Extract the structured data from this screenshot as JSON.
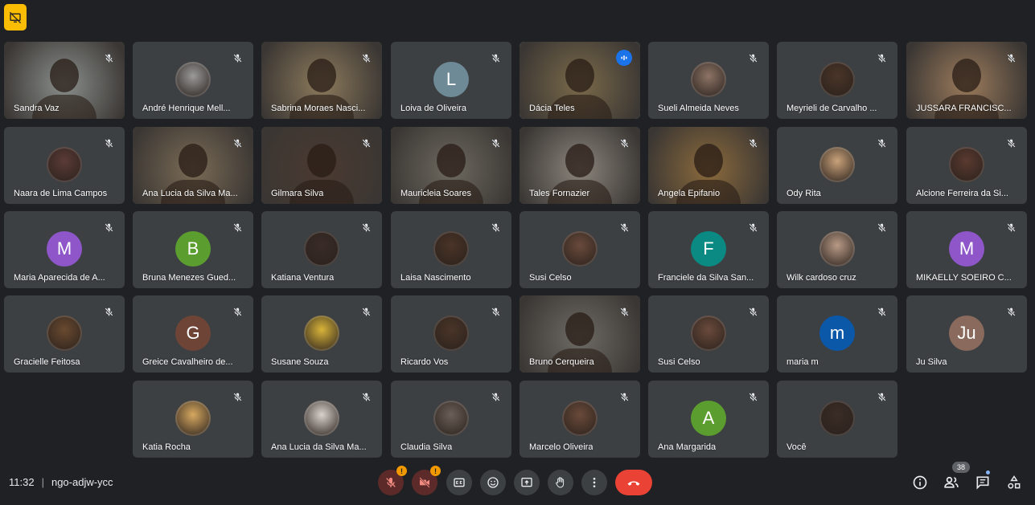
{
  "meeting": {
    "time": "11:32",
    "separator": "|",
    "code": "ngo-adjw-ycc",
    "participant_count": "38"
  },
  "participants": [
    {
      "name": "Sandra Vaz",
      "kind": "video",
      "bg": "#8a8f8c"
    },
    {
      "name": "André Henrique Mell...",
      "kind": "photo",
      "color": "#9a9a9a"
    },
    {
      "name": "Sabrina Moraes Nasci...",
      "kind": "video",
      "bg": "#8c7a5c"
    },
    {
      "name": "Loiva de Oliveira",
      "kind": "letter",
      "letter": "L",
      "color": "#6e8a96"
    },
    {
      "name": "Dácia Teles",
      "kind": "video",
      "bg": "#7a6a4a",
      "active": true
    },
    {
      "name": "Sueli Almeida Neves",
      "kind": "photo",
      "color": "#8d7466"
    },
    {
      "name": "Meyrieli de Carvalho ...",
      "kind": "photo",
      "color": "#4a3528"
    },
    {
      "name": "JUSSARA FRANCISC...",
      "kind": "video",
      "bg": "#9b7b5c"
    },
    {
      "name": "Naara de Lima Campos",
      "kind": "photo",
      "color": "#5b3b37"
    },
    {
      "name": "Ana Lucia da Silva Ma...",
      "kind": "video",
      "bg": "#7a6b55"
    },
    {
      "name": "Gilmara Silva",
      "kind": "video",
      "bg": "#4b3a31"
    },
    {
      "name": "Mauricleia Soares",
      "kind": "video",
      "bg": "#6e6a60"
    },
    {
      "name": "Tales Fornazier",
      "kind": "video",
      "bg": "#8b857c"
    },
    {
      "name": "Angela Epifanio",
      "kind": "video",
      "bg": "#8b6a3c"
    },
    {
      "name": "Ody Rita",
      "kind": "photo",
      "color": "#c9a27a"
    },
    {
      "name": "Alcione Ferreira da Si...",
      "kind": "photo",
      "color": "#5a3a30"
    },
    {
      "name": "Maria Aparecida de A...",
      "kind": "letter",
      "letter": "M",
      "color": "#8e56c8"
    },
    {
      "name": "Bruna Menezes Gued...",
      "kind": "letter",
      "letter": "B",
      "color": "#5b9e2f"
    },
    {
      "name": "Katiana Ventura",
      "kind": "photo",
      "color": "#3a2c28"
    },
    {
      "name": "Laisa Nascimento",
      "kind": "photo",
      "color": "#4a3427"
    },
    {
      "name": "Susi Celso",
      "kind": "photo",
      "color": "#6a4a3c"
    },
    {
      "name": "Franciele da Silva San...",
      "kind": "letter",
      "letter": "F",
      "color": "#0a8a82"
    },
    {
      "name": "Wilk cardoso cruz",
      "kind": "photo",
      "color": "#b89a86"
    },
    {
      "name": "MIKAELLY SOEIRO C...",
      "kind": "letter",
      "letter": "M",
      "color": "#8e56c8"
    },
    {
      "name": "Gracielle Feitosa",
      "kind": "photo",
      "color": "#6a4a30"
    },
    {
      "name": "Greice Cavalheiro de...",
      "kind": "letter",
      "letter": "G",
      "color": "#6d4436"
    },
    {
      "name": "Susane Souza",
      "kind": "photo",
      "color": "#d9b43a"
    },
    {
      "name": "Ricardo Vos",
      "kind": "photo",
      "color": "#4a3528"
    },
    {
      "name": "Bruno Cerqueira",
      "kind": "video",
      "bg": "#6e6a64"
    },
    {
      "name": "Susi Celso",
      "kind": "photo",
      "color": "#6a4a3c"
    },
    {
      "name": "maria m",
      "kind": "letter",
      "letter": "m",
      "color": "#0b57a8"
    },
    {
      "name": "Ju Silva",
      "kind": "letter",
      "letter": "Ju",
      "color": "#8a6a5c"
    },
    {
      "name": "Katia Rocha",
      "kind": "photo",
      "color": "#d6a860"
    },
    {
      "name": "Ana Lucia da Silva Ma...",
      "kind": "photo",
      "color": "#d9d2cc"
    },
    {
      "name": "Claudia Silva",
      "kind": "photo",
      "color": "#6b6058"
    },
    {
      "name": "Marcelo Oliveira",
      "kind": "photo",
      "color": "#6a4a3a"
    },
    {
      "name": "Ana Margarida",
      "kind": "letter",
      "letter": "A",
      "color": "#5b9e2f"
    },
    {
      "name": "Você",
      "kind": "photo",
      "color": "#3a2c26"
    }
  ],
  "controls": {
    "mic_icon": "mic-off-icon",
    "camera_icon": "videocam-off-icon",
    "warn_mark": "!",
    "captions_icon": "closed-caption-icon",
    "reactions_icon": "emoji-icon",
    "present_icon": "present-screen-icon",
    "raise_hand_icon": "hand-icon",
    "more_icon": "more-vert-icon",
    "hangup_icon": "call-end-icon",
    "info_icon": "info-icon",
    "people_icon": "people-icon",
    "chat_icon": "chat-icon",
    "activities_icon": "activities-icon"
  },
  "colors": {
    "background": "#202124",
    "tile": "#3c4043",
    "active_outline": "#8ab4f8",
    "hangup": "#ea4335",
    "present_badge": "#fbbc04",
    "warning": "#f29900"
  }
}
